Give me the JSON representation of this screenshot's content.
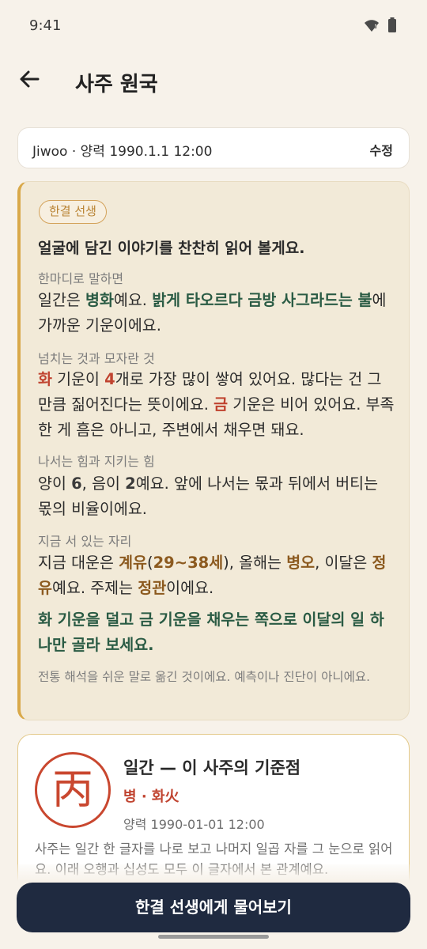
{
  "status": {
    "time": "9:41"
  },
  "header": {
    "title": "사주 원국"
  },
  "info_bar": {
    "text": "Jiwoo · 양력 1990.1.1 12:00",
    "edit_label": "수정"
  },
  "teacher_card": {
    "badge": "한결 선생",
    "headline": "얼굴에 담긴 이야기를 찬찬히 읽어 볼게요.",
    "summary": {
      "label": "한마디로 말하면",
      "t1": "일간은 ",
      "t2": "병화",
      "t3": "예요. ",
      "t4": "밝게 타오르다 금방 사그라드는 불",
      "t5": "에 가까운 기운이에요."
    },
    "balance": {
      "label": "넘치는 것과 모자란 것",
      "t1": "화",
      "t2": " 기운이 ",
      "t3": "4",
      "t4": "개로 가장 많이 쌓여 있어요. 많다는 건 그만큼 짊어진다는 뜻이에요. ",
      "t5": "금",
      "t6": " 기운은 비어 있어요. 부족한 게 흠은 아니고, 주변에서 채우면 돼요."
    },
    "yinyang": {
      "label": "나서는 힘과 지키는 힘",
      "t1": "양이 ",
      "t2": "6",
      "t3": ", 음이 ",
      "t4": "2",
      "t5": "예요. 앞에 나서는 몫과 뒤에서 버티는 몫의 비율이에요."
    },
    "current": {
      "label": "지금 서 있는 자리",
      "t1": "지금 대운은 ",
      "t2": "계유",
      "t3": "(",
      "t4": "29~38세",
      "t5": "), 올해는 ",
      "t6": "병오",
      "t7": ", 이달은 ",
      "t8": "정유",
      "t9": "예요. 주제는 ",
      "t10": "정관",
      "t11": "이에요."
    },
    "advice": "화 기운을 덜고 금 기운을 채우는 쪽으로 이달의 일 하나만 골라 보세요.",
    "disclaimer": "전통 해석을 쉬운 말로 옮긴 것이에요. 예측이나 진단이 아니에요."
  },
  "ilgan_card": {
    "char": "丙",
    "title": "일간 — 이 사주의 기준점",
    "subtitle": "병 · 화火",
    "date": "양력 1990-01-01 12:00",
    "desc": "사주는 일간 한 글자를 나로 보고 나머지 일곱 자를 그 눈으로 읽어요. 이래 오행과 십성도 모두 이 글자에서 본 관계예요."
  },
  "cta": {
    "label": "한결 선생에게 물어보기"
  },
  "colors": {
    "accent_gold": "#d9a94a",
    "fire_red": "#c0432f",
    "green": "#2a5b44",
    "navy": "#1f2a40"
  },
  "icons": {
    "back": "arrow-left-icon",
    "wifi": "wifi-icon",
    "battery": "battery-icon"
  }
}
